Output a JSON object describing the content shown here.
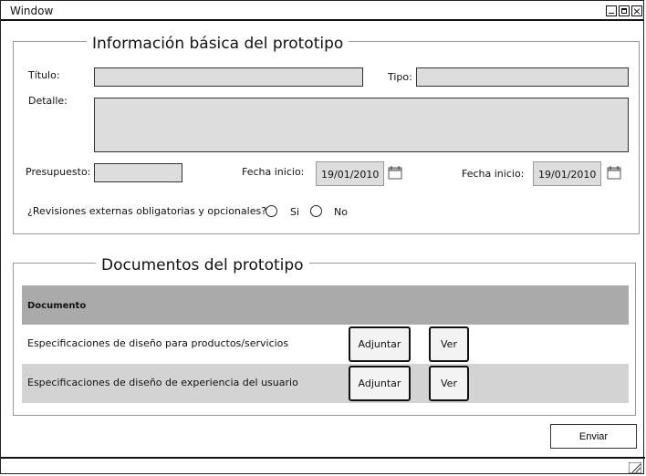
{
  "window": {
    "title": "Window"
  },
  "section1": {
    "legend": "Información básica del prototipo",
    "titulo_label": "Título:",
    "titulo_value": "",
    "tipo_label": "Tipo:",
    "tipo_value": "",
    "detalle_label": "Detalle:",
    "detalle_value": "",
    "presupuesto_label": "Presupuesto:",
    "presupuesto_value": "",
    "fecha1_label": "Fecha inicio:",
    "fecha1_value": "19/01/2010",
    "fecha2_label": "Fecha inicio:",
    "fecha2_value": "19/01/2010",
    "revisiones_label": "¿Revisiones externas obligatorias y opcionales?",
    "radio_si": "Si",
    "radio_no": "No"
  },
  "section2": {
    "legend": "Documentos del prototipo",
    "column_header": "Documento",
    "rows": [
      {
        "label": "Especificaciones de diseño para productos/servicios",
        "attach": "Adjuntar",
        "view": "Ver"
      },
      {
        "label": "Especificaciones de diseño de experiencia del usuario",
        "attach": "Adjuntar",
        "view": "Ver"
      }
    ]
  },
  "footer": {
    "submit_label": "Enviar"
  },
  "colors": {
    "field_bg": "#dddddd",
    "header_bg": "#aaaaaa",
    "alt_row_bg": "#d3d3d3"
  },
  "icons": {
    "calendar": "calendar-icon",
    "resize": "resize-grip-icon"
  }
}
